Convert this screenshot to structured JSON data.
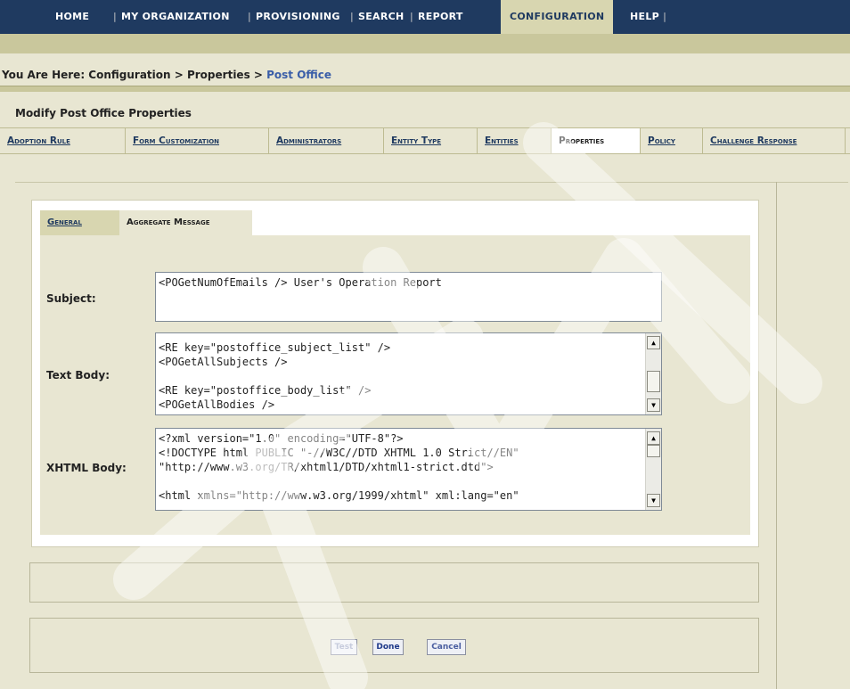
{
  "nav": {
    "items": [
      "HOME",
      "MY ORGANIZATION",
      "PROVISIONING",
      "SEARCH",
      "REPORT",
      "CONFIGURATION",
      "HELP"
    ],
    "separator": "|",
    "active": "CONFIGURATION"
  },
  "breadcrumb": {
    "prefix": "You Are Here: Configuration > Properties > ",
    "current": "Post Office"
  },
  "page_title": "Modify Post Office Properties",
  "tabs": [
    "Adoption Rule",
    "Form Customization",
    "Administrators",
    "Entity Type",
    "Entities",
    "Properties",
    "Policy",
    "Challenge Response"
  ],
  "active_tab": "Properties",
  "subtabs": {
    "general": "General",
    "aggregate": "Aggregate Message"
  },
  "fields": {
    "subject": {
      "label": "Subject:",
      "lines": [
        "<POGetNumOfEmails /> User's Operation Report"
      ]
    },
    "text_body": {
      "label": "Text Body:",
      "lines": [
        "<RE key=\"postoffice_subject_list\" />",
        "<POGetAllSubjects />",
        "",
        "<RE key=\"postoffice_body_list\" />",
        "<POGetAllBodies />"
      ]
    },
    "xhtml_body": {
      "label": "XHTML Body:",
      "lines": [
        "<?xml version=\"1.0\" encoding=\"UTF-8\"?>",
        "<!DOCTYPE html PUBLIC \"-//W3C//DTD XHTML 1.0 Strict//EN\"",
        "\"http://www.w3.org/TR/xhtml1/DTD/xhtml1-strict.dtd\">",
        "",
        "<html xmlns=\"http://www.w3.org/1999/xhtml\" xml:lang=\"en\""
      ]
    }
  },
  "buttons": {
    "test": "Test",
    "done": "Done",
    "cancel": "Cancel"
  },
  "colors": {
    "nav_bg": "#1f3a60",
    "page_bg": "#e8e6d2",
    "olive": "#c9c79c",
    "link": "#1f3a60"
  }
}
